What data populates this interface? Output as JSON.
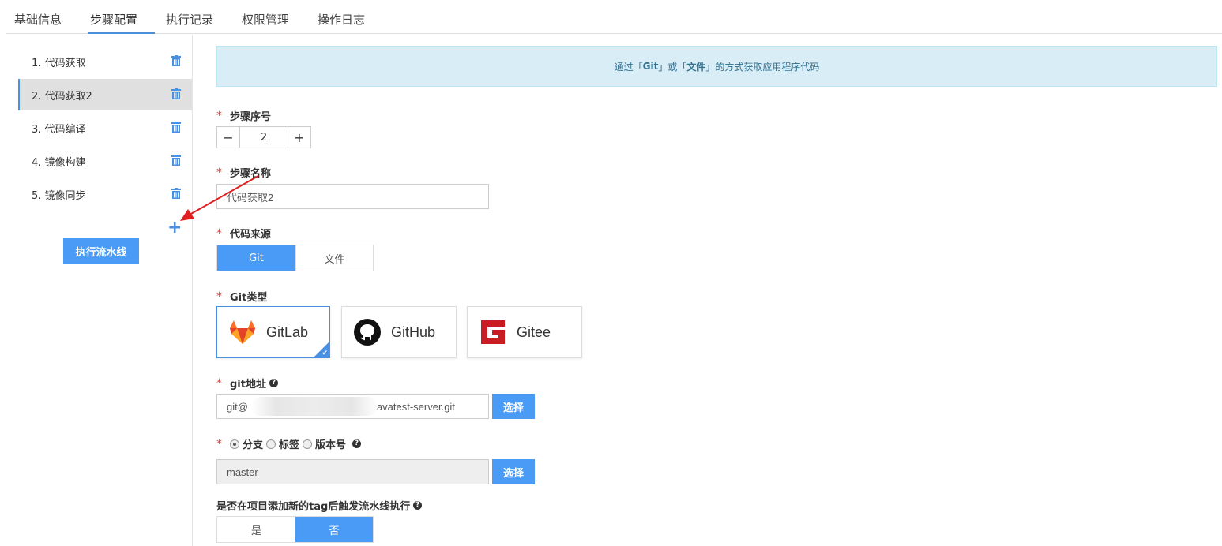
{
  "tabs": [
    {
      "label": "基础信息"
    },
    {
      "label": "步骤配置"
    },
    {
      "label": "执行记录"
    },
    {
      "label": "权限管理"
    },
    {
      "label": "操作日志"
    }
  ],
  "active_tab": "步骤配置",
  "sidebar": {
    "steps": [
      {
        "label": "1. 代码获取"
      },
      {
        "label": "2. 代码获取2"
      },
      {
        "label": "3. 代码编译"
      },
      {
        "label": "4. 镜像构建"
      },
      {
        "label": "5. 镜像同步"
      }
    ],
    "active_step": "2. 代码获取2",
    "add_label": "+",
    "run_button": "执行流水线"
  },
  "banner": {
    "prefix": "通过「",
    "git": "Git",
    "middle": "」或「",
    "file": "文件",
    "suffix": "」的方式获取应用程序代码"
  },
  "form": {
    "step_number": {
      "label": "步骤序号",
      "value": "2",
      "minus": "−",
      "plus": "+"
    },
    "step_name": {
      "label": "步骤名称",
      "value": "代码获取2"
    },
    "code_source": {
      "label": "代码来源",
      "options": [
        "Git",
        "文件"
      ],
      "selected": "Git"
    },
    "git_type": {
      "label": "Git类型",
      "options": [
        {
          "name": "GitLab",
          "icon": "gitlab-logo"
        },
        {
          "name": "GitHub",
          "icon": "github-logo"
        },
        {
          "name": "Gitee",
          "icon": "gitee-logo"
        }
      ],
      "selected": "GitLab"
    },
    "git_url": {
      "label": "git地址",
      "prefix": "git@",
      "suffix": "avatest-server.git",
      "select_button": "选择"
    },
    "ref_type": {
      "options": [
        "分支",
        "标签",
        "版本号"
      ],
      "selected": "分支"
    },
    "ref_value": {
      "value": "master",
      "select_button": "选择"
    },
    "tag_trigger": {
      "label": "是否在项目添加新的tag后触发流水线执行",
      "options": [
        "是",
        "否"
      ],
      "selected": "否"
    }
  },
  "colors": {
    "accent": "#4a9bf5",
    "required": "#e53935",
    "arrow": "#e02020"
  }
}
